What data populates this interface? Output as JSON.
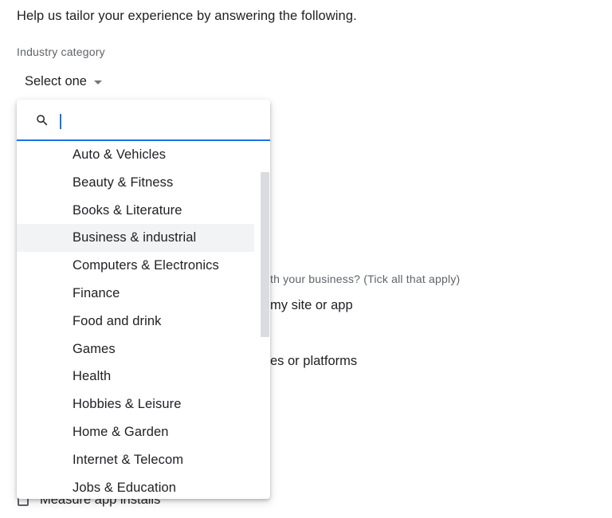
{
  "intro": {
    "text": "Help us tailor your experience by answering the following."
  },
  "industry": {
    "label": "Industry category",
    "selected": "Select one",
    "search_placeholder": "",
    "search_value": "",
    "hovered_index": 3,
    "options": [
      "Auto & Vehicles",
      "Beauty & Fitness",
      "Books & Literature",
      "Business & industrial",
      "Computers & Electronics",
      "Finance",
      "Food and drink",
      "Games",
      "Health",
      "Hobbies & Leisure",
      "Home & Garden",
      "Internet & Telecom",
      "Jobs & Education"
    ]
  },
  "background_form": {
    "question_fragment": "th your business? (Tick all that apply)",
    "option1_fragment": "my site or app",
    "option2_fragment": "es or platforms",
    "measure_app_installs": "Measure app installs"
  },
  "icons": {
    "search": "search-icon",
    "caret": "caret-down-icon"
  },
  "colors": {
    "accent": "#1a73e8",
    "hover": "#f1f3f4",
    "scrollbar": "#dadce0"
  }
}
